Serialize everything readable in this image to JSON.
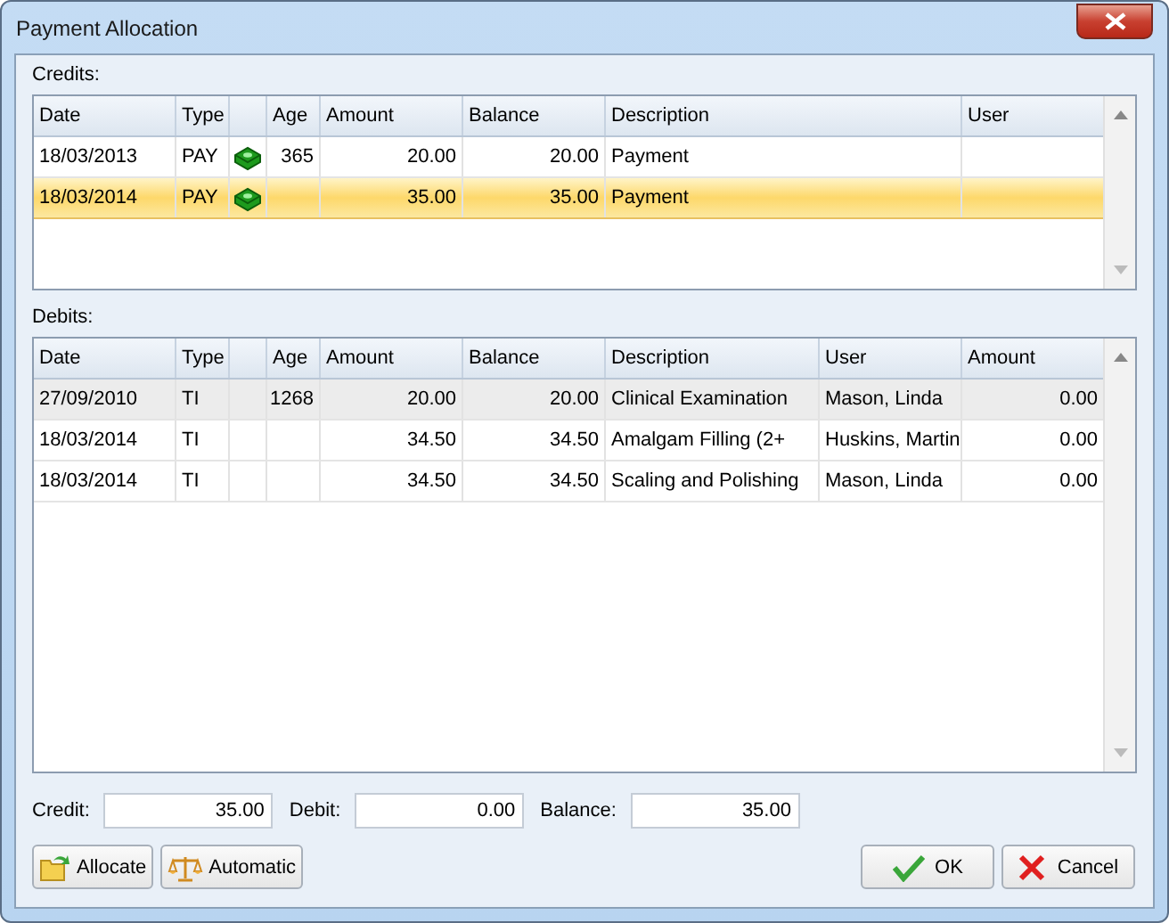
{
  "window": {
    "title": "Payment Allocation"
  },
  "tables": [
    {
      "label": "Credits:",
      "active": true,
      "columns": [
        {
          "label": "Date",
          "kind": "text"
        },
        {
          "label": "Type",
          "kind": "text"
        },
        {
          "kind": "icon"
        },
        {
          "label": "Age",
          "kind": "number"
        },
        {
          "label": "Amount",
          "kind": "number"
        },
        {
          "label": "Balance",
          "kind": "number"
        },
        {
          "label": "Description",
          "kind": "text"
        },
        {
          "label": "User",
          "kind": "text"
        }
      ],
      "rows": [
        {
          "selected": false,
          "has_icon": true,
          "cells": [
            "18/03/2013",
            "PAY",
            null,
            "365",
            "20.00",
            "20.00",
            "Payment",
            null
          ]
        },
        {
          "selected": true,
          "has_icon": true,
          "cells": [
            "18/03/2014",
            "PAY",
            null,
            null,
            "35.00",
            "35.00",
            "Payment",
            null
          ]
        }
      ]
    },
    {
      "label": "Debits:",
      "active": false,
      "columns": [
        {
          "label": "Date",
          "kind": "text"
        },
        {
          "label": "Type",
          "kind": "text"
        },
        {
          "kind": "icon"
        },
        {
          "label": "Age",
          "kind": "number"
        },
        {
          "label": "Amount",
          "kind": "number"
        },
        {
          "label": "Balance",
          "kind": "number"
        },
        {
          "label": "Description",
          "kind": "text"
        },
        {
          "label": "User",
          "kind": "text"
        },
        {
          "label": "Amount",
          "kind": "number"
        }
      ],
      "rows": [
        {
          "selected": true,
          "has_icon": false,
          "cells": [
            "27/09/2010",
            "TI",
            null,
            "1268",
            "20.00",
            "20.00",
            "Clinical Examination",
            "Mason, Linda",
            "0.00"
          ]
        },
        {
          "selected": false,
          "has_icon": false,
          "cells": [
            "18/03/2014",
            "TI",
            null,
            null,
            "34.50",
            "34.50",
            "Amalgam Filling (2+",
            "Huskins, Martin",
            "0.00"
          ]
        },
        {
          "selected": false,
          "has_icon": false,
          "cells": [
            "18/03/2014",
            "TI",
            null,
            null,
            "34.50",
            "34.50",
            "Scaling and Polishing",
            "Mason, Linda",
            "0.00"
          ]
        }
      ]
    }
  ],
  "totals": [
    {
      "label": "Credit:",
      "value": "35.00"
    },
    {
      "label": "Debit:",
      "value": "0.00"
    },
    {
      "label": "Balance:",
      "value": "35.00"
    }
  ],
  "left_buttons": [
    "Allocate",
    "Automatic"
  ],
  "right_buttons": [
    "OK",
    "Cancel"
  ]
}
